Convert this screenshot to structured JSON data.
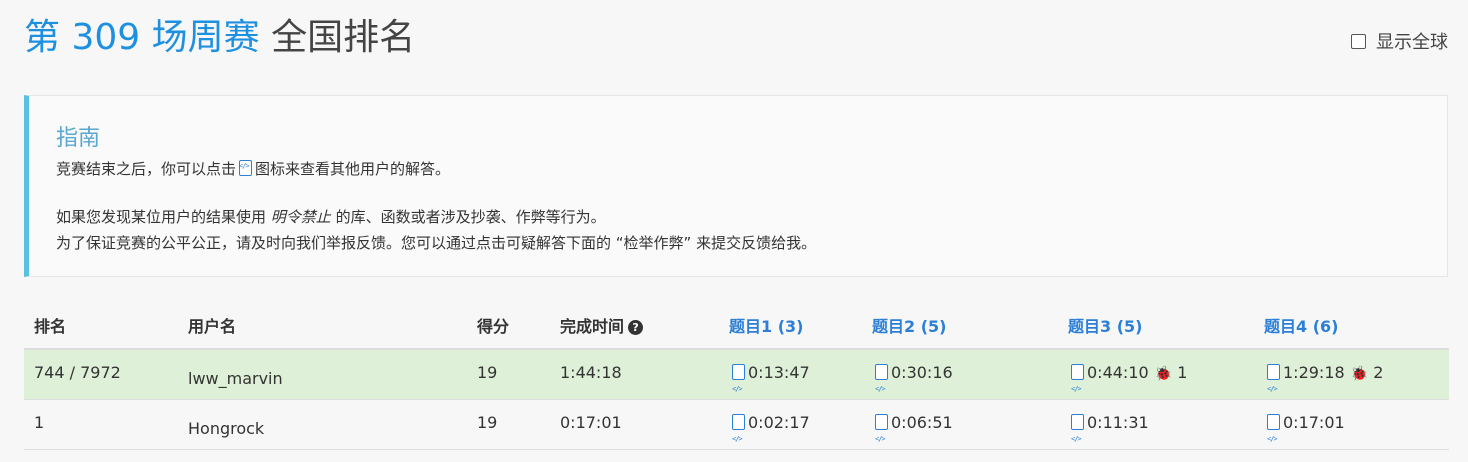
{
  "header": {
    "contest": "第 309 场周赛",
    "subtitle": "全国排名",
    "global_label": "显示全球"
  },
  "guide": {
    "title": "指南",
    "line1_pre": "竞赛结束之后，你可以点击",
    "line1_post": "图标来查看其他用户的解答。",
    "line2_pre": "如果您发现某位用户的结果使用",
    "line2_em": "明令禁止",
    "line2_post": "的库、函数或者涉及抄袭、作弊等行为。",
    "line3": "为了保证竞赛的公平公正，请及时向我们举报反馈。您可以通过点击可疑解答下面的 “检举作弊” 来提交反馈给我。"
  },
  "table": {
    "headers": {
      "rank": "排名",
      "user": "用户名",
      "score": "得分",
      "time": "完成时间",
      "q1": "题目1 (3)",
      "q2": "题目2 (5)",
      "q3": "题目3 (5)",
      "q4": "题目4 (6)"
    },
    "rows": [
      {
        "rank": "744 / 7972",
        "user": "lww_marvin",
        "score": "19",
        "time": "1:44:18",
        "q1": "0:13:47",
        "q2": "0:30:16",
        "q3": "0:44:10",
        "q3_bugs": "1",
        "q4": "1:29:18",
        "q4_bugs": "2"
      },
      {
        "rank": "1",
        "user": "Hongrock",
        "score": "19",
        "time": "0:17:01",
        "q1": "0:02:17",
        "q2": "0:06:51",
        "q3": "0:11:31",
        "q4": "0:17:01"
      }
    ]
  },
  "icons": {
    "solution": "code-file-icon",
    "help": "question-circle-icon",
    "bug": "bug-icon"
  },
  "colors": {
    "accent_blue": "#1e90e0",
    "guide_border": "#5bc0de",
    "highlight_row": "#dff0d8",
    "bug_red": "#c0392b"
  }
}
